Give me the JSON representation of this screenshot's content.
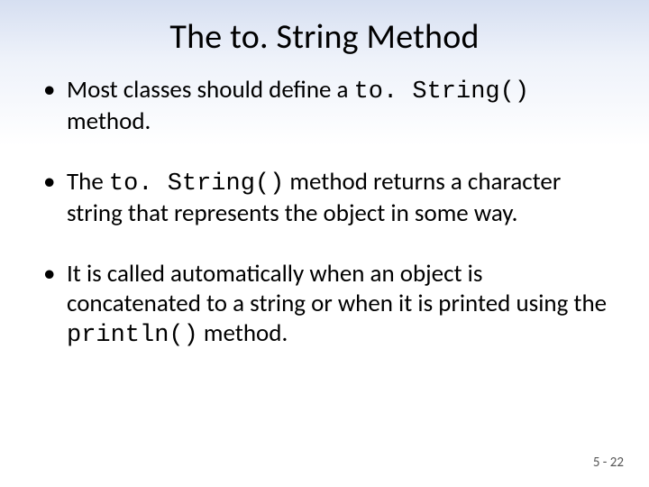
{
  "title": "The to. String Method",
  "bullets": [
    {
      "pre": "Most classes should define a ",
      "code": "to. String()",
      "post": " method."
    },
    {
      "pre": "The ",
      "code": "to. String()",
      "post": " method returns a character string that represents the object in some way."
    },
    {
      "pre": "It is called automatically when an object is concatenated to a string or when it is printed using the ",
      "code": "println()",
      "post": " method."
    }
  ],
  "footer": "5 - 22"
}
